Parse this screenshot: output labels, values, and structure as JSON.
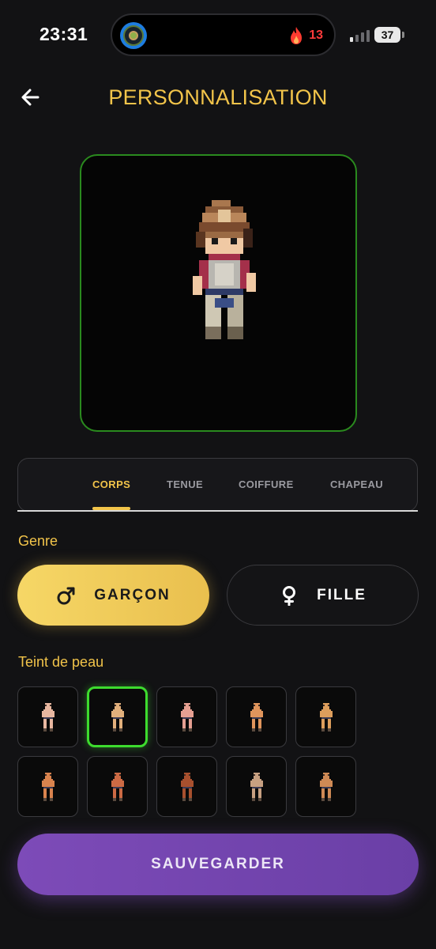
{
  "status_bar": {
    "time": "23:31",
    "streak_count": "13",
    "battery": "37"
  },
  "header": {
    "title": "PERSONNALISATION",
    "back_icon": "arrow-left-icon"
  },
  "tabs": [
    {
      "label": "CORPS",
      "active": true
    },
    {
      "label": "TENUE",
      "active": false
    },
    {
      "label": "COIFFURE",
      "active": false
    },
    {
      "label": "CHAPEAU",
      "active": false
    }
  ],
  "gender": {
    "label": "Genre",
    "options": [
      {
        "label": "GARÇON",
        "icon": "male-symbol-icon",
        "selected": true
      },
      {
        "label": "FILLE",
        "icon": "female-symbol-icon",
        "selected": false
      }
    ]
  },
  "skin_tone": {
    "label": "Teint de peau",
    "selected_index": 1,
    "tones": [
      "#e8b7a0",
      "#e2b07c",
      "#e6a092",
      "#e0955c",
      "#dd9e5c",
      "#d9834e",
      "#cc6a44",
      "#a8502e",
      "#c7a081",
      "#cf8a55"
    ]
  },
  "save_label": "SAUVEGARDER",
  "colors": {
    "accent": "#f2c44a",
    "preview_border": "#2a8a1e",
    "selected_swatch": "#3ddc2e",
    "save_button": "#7d4bb8"
  }
}
